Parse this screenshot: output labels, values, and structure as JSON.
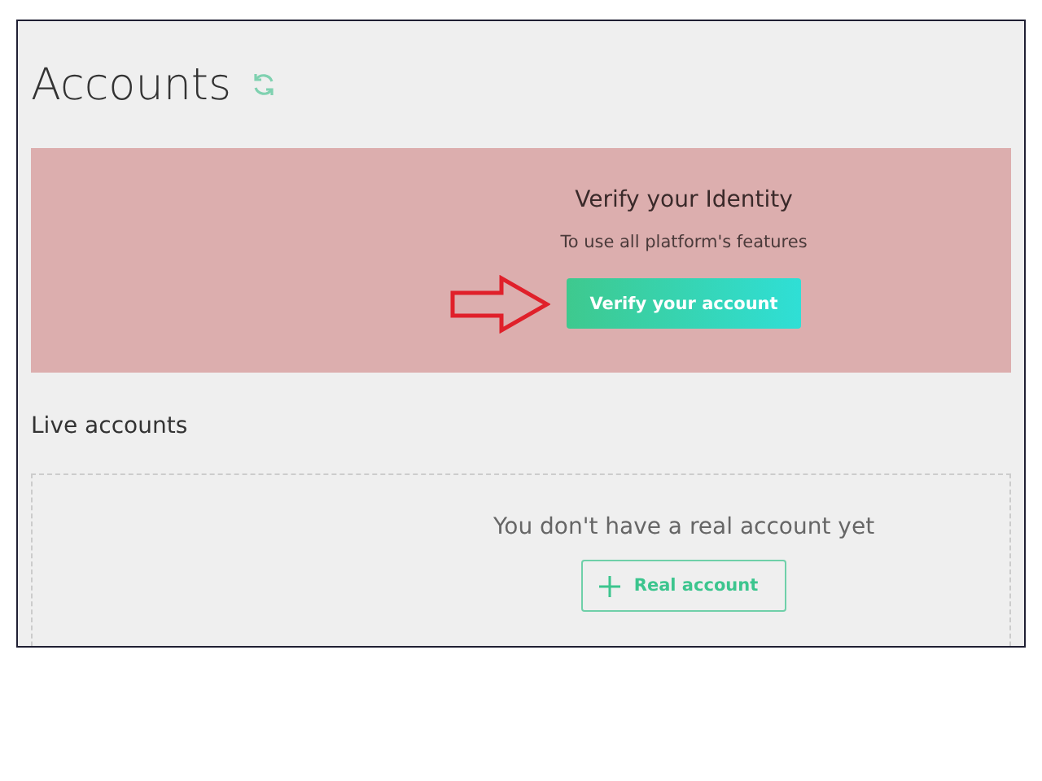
{
  "header": {
    "title": "Accounts"
  },
  "verify_banner": {
    "title": "Verify your Identity",
    "subtitle": "To use all platform's features",
    "button": "Verify your account"
  },
  "live_accounts": {
    "heading": "Live accounts",
    "empty_message": "You don't have a real account yet",
    "button": "Real account"
  }
}
